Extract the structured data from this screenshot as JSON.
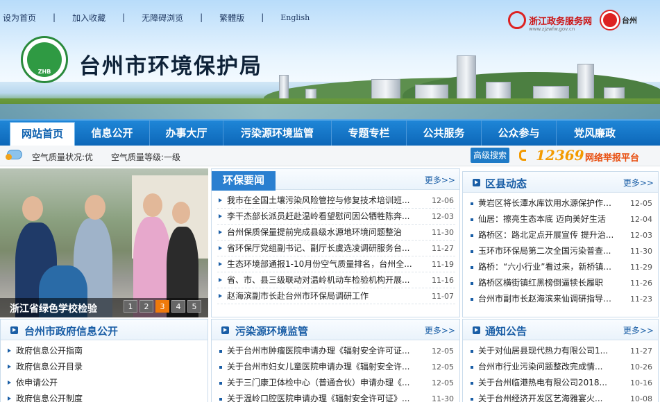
{
  "topnav": {
    "links": [
      "设为首页",
      "加入收藏",
      "无障碍浏览",
      "繁體版",
      "English"
    ],
    "separator": "|"
  },
  "site": {
    "title": "台州市环境保护局",
    "logo_text": "ZHB",
    "partner1": {
      "name": "浙江政务服务网",
      "sub": "www.zjzwfw.gov.cn"
    },
    "partner2": {
      "name": "台州"
    }
  },
  "mainnav": [
    "网站首页",
    "信息公开",
    "办事大厅",
    "污染源环境监管",
    "专题专栏",
    "公共服务",
    "公众参与",
    "党风廉政"
  ],
  "status": {
    "air_quality": "空气质量状况:优",
    "air_level": "空气质量等级:一级",
    "advanced_search": "高级搜索",
    "hotline": "12369",
    "report_platform": "网络举报平台"
  },
  "slideshow": {
    "caption": "浙江省绿色学校检验",
    "pages": [
      "1",
      "2",
      "3",
      "4",
      "5"
    ],
    "active_page": 3
  },
  "news": {
    "title": "环保要闻",
    "more": "更多>>",
    "items": [
      {
        "text": "我市在全国土壤污染风险管控与修复技术培训班...",
        "date": "12-06"
      },
      {
        "text": "李干杰部长派员赶赴温岭看望慰问因公牺牲陈奔...",
        "date": "12-03"
      },
      {
        "text": "台州保质保量提前完成县级水源地环境问题整治",
        "date": "11-30"
      },
      {
        "text": "省环保厅党组副书记、副厅长虞选凌调研服务台...",
        "date": "11-27"
      },
      {
        "text": "生态环境部通报1-10月份空气质量排名，台州全...",
        "date": "11-19"
      },
      {
        "text": "省、市、县三级联动对温岭机动车检验机构开展...",
        "date": "11-16"
      },
      {
        "text": "赵海滨副市长赴台州市环保局调研工作",
        "date": "11-07"
      }
    ]
  },
  "district": {
    "title": "区县动态",
    "more": "更多>>",
    "items": [
      {
        "text": "黄岩区将长潭水库饮用水源保护作为...",
        "date": "12-05"
      },
      {
        "text": "仙居：擦亮生态本底 迈向美好生活",
        "date": "12-04"
      },
      {
        "text": "路桥区：路北定点开展宣传 提升治...",
        "date": "12-03"
      },
      {
        "text": "玉环市环保局第二次全国污染普查...",
        "date": "11-30"
      },
      {
        "text": "路桥：“六小行业”看过来，新桥镇...",
        "date": "11-29"
      },
      {
        "text": "路桥区横街镇红黑榜倒逼犊长履职",
        "date": "11-26"
      },
      {
        "text": "台州市副市长赵海滨来仙调研指导耒...",
        "date": "11-23"
      }
    ]
  },
  "govinfo": {
    "title": "台州市政府信息公开",
    "items": [
      "政府信息公开指南",
      "政府信息公开目录",
      "依申请公开",
      "政府信息公开制度"
    ]
  },
  "pollution": {
    "title": "污染源环境监管",
    "more": "更多>>",
    "items": [
      {
        "text": "关于台州市肿瘤医院申请办理《辐射安全许可证...",
        "date": "12-05"
      },
      {
        "text": "关于台州市妇女儿童医院申请办理《辐射安全许...",
        "date": "12-05"
      },
      {
        "text": "关于三门康卫体检中心（普通合伙）申请办理《...",
        "date": "12-05"
      },
      {
        "text": "关于温岭口腔医院申请办理《辐射安全许可证》...",
        "date": "11-30"
      }
    ]
  },
  "notice": {
    "title": "通知公告",
    "more": "更多>>",
    "items": [
      {
        "text": "关于对仙居县现代热力有限公司1...",
        "date": "11-27"
      },
      {
        "text": "台州市行业污染问题整改完成情...",
        "date": "10-26"
      },
      {
        "text": "关于台州临港热电有限公司2018...",
        "date": "10-16"
      },
      {
        "text": "关于台州经济开发区艺海雅宴火...",
        "date": "10-08"
      }
    ]
  },
  "colors": {
    "nav_blue": "#0d67b8",
    "title_blue": "#1a5ea6",
    "hotline_orange": "#f39a00",
    "report_red": "#e84d0e",
    "active_dot": "#ef7a0b"
  }
}
